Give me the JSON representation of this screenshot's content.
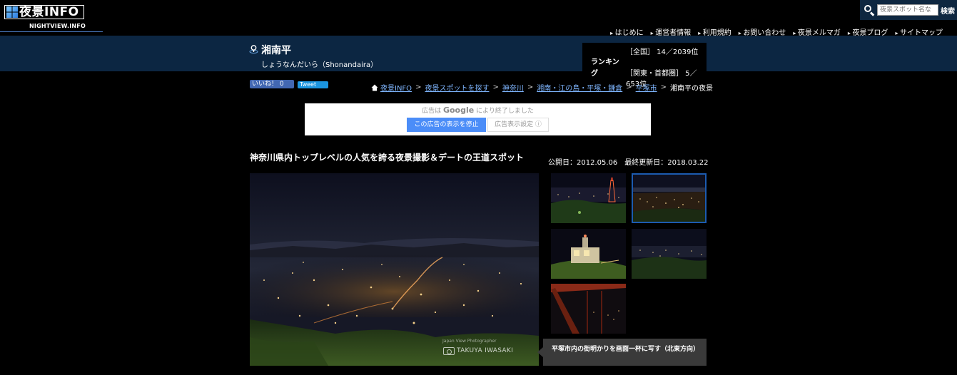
{
  "site": {
    "logo_text": "夜景INFO",
    "logo_sub": "NIGHTVIEW.INFO",
    "logo_icon": "grid-logo-icon"
  },
  "search": {
    "placeholder": "夜景スポット名な",
    "button": "検索"
  },
  "topnav": [
    "はじめに",
    "運営者情報",
    "利用規約",
    "お問い合わせ",
    "夜景メルマガ",
    "夜景ブログ",
    "サイトマップ"
  ],
  "spot": {
    "title": "湘南平",
    "reading": "しょうなんだいら（Shonandaira）"
  },
  "ranking": {
    "label": "ランキング",
    "national": "［全国］ 14／2039位",
    "regional": "［関東・首都圏］ 5／653位"
  },
  "social": {
    "like": "いいね！ 0",
    "tweet": "Tweet"
  },
  "breadcrumb": {
    "items": [
      "夜景INFO",
      "夜景スポットを探す",
      "神奈川",
      "湘南・江の島・平塚・鎌倉",
      "平塚市"
    ],
    "current": "湘南平の夜景"
  },
  "ad": {
    "message_pre": "広告は",
    "message_brand": "Google",
    "message_post": "により終了しました",
    "stop_button": "この広告の表示を停止",
    "settings_button": "広告表示設定 ⓘ"
  },
  "content": {
    "catchcopy": "神奈川県内トップレベルの人気を誇る夜景撮影＆デートの王道スポット",
    "dates": "公開日：2012.05.06　最終更新日：2018.03.22",
    "photo_credit_small": "Japan View Photographer",
    "photo_credit_name": "TAKUYA IWASAKI",
    "caption": "平塚市内の街明かりを画面一杯に写す（北東方向）"
  },
  "colors": {
    "band": "#0c2642",
    "link": "#7fb6ff",
    "active_thumb_border": "#1c5bb0",
    "ad_button": "#4b8df8"
  }
}
